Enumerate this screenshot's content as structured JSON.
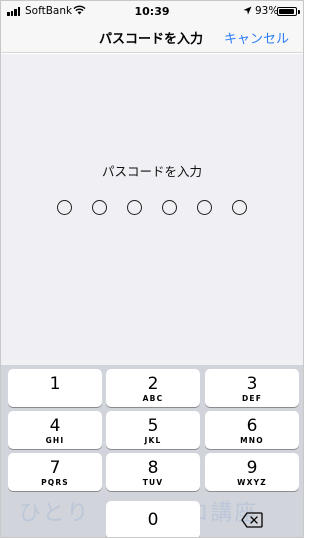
{
  "status_bar": {
    "carrier": "SoftBank",
    "time": "10:39",
    "battery_percent": "93%",
    "battery_level": 0.93,
    "icons": [
      "signal-icon",
      "wifi-icon",
      "location-arrow-icon",
      "battery-icon"
    ]
  },
  "nav": {
    "title": "パスコードを入力",
    "cancel_label": "キャンセル"
  },
  "passcode": {
    "prompt": "パスコードを入力",
    "length": 6,
    "entered": 0
  },
  "keypad": {
    "keys": [
      {
        "digit": "1",
        "letters": ""
      },
      {
        "digit": "2",
        "letters": "ABC"
      },
      {
        "digit": "3",
        "letters": "DEF"
      },
      {
        "digit": "4",
        "letters": "GHI"
      },
      {
        "digit": "5",
        "letters": "JKL"
      },
      {
        "digit": "6",
        "letters": "MNO"
      },
      {
        "digit": "7",
        "letters": "PQRS"
      },
      {
        "digit": "8",
        "letters": "TUV"
      },
      {
        "digit": "9",
        "letters": "WXYZ"
      },
      {
        "digit": "0",
        "letters": ""
      }
    ]
  },
  "watermark": "ひとり　　　　ロ講座",
  "colors": {
    "accent": "#2b7cf6",
    "content_bg": "#efeff4",
    "keypad_bg": "#d1d4da"
  }
}
